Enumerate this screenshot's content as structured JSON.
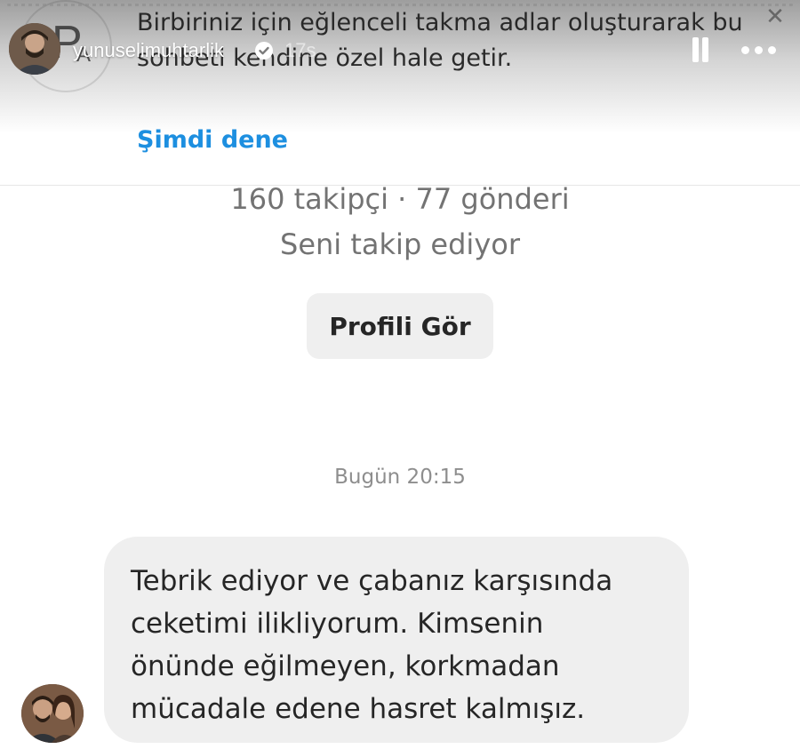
{
  "story": {
    "username": "yunuselimuhtarlik",
    "time_ago": "17s"
  },
  "tip": {
    "text": "Birbiriniz için eğlenceli takma adlar oluşturarak bu sohbeti kendine özel hale getir.",
    "action_label": "Şimdi dene",
    "close_symbol": "✕"
  },
  "profile": {
    "stats": "160 takipçi · 77 gönderi",
    "follow_status": "Seni takip ediyor",
    "view_profile_label": "Profili Gör"
  },
  "conversation": {
    "timestamp": "Bugün 20:15",
    "message": "Tebrik ediyor ve çabanız karşısında\nceketimi ilikliyorum. Kimsenin\nönünde eğilmeyen, korkmadan\nmücadale edene hasret kalmışız."
  },
  "icons": {
    "tip_icon": "nickname-icon",
    "close": "close-icon",
    "verified": "verified-badge-icon",
    "pause": "pause-icon",
    "more": "more-options-icon"
  },
  "colors": {
    "link_blue": "#1d8fe0",
    "bubble_gray": "#efefef",
    "muted_text": "#737373"
  }
}
